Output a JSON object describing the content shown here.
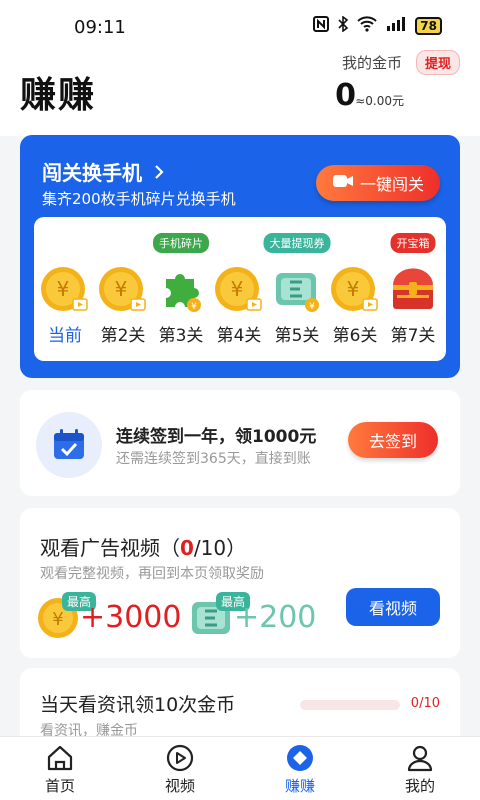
{
  "status_bar": {
    "time": "09:11",
    "battery": "78",
    "icons": [
      "nfc-icon",
      "bluetooth-icon",
      "wifi-icon",
      "signal-icon",
      "battery-icon"
    ]
  },
  "header": {
    "title": "赚赚",
    "coins_label": "我的金币",
    "withdraw_label": "提现",
    "coins_value": "0",
    "money_value": "≈0.00元"
  },
  "challenge": {
    "title": "闯关换手机",
    "subtitle": "集齐200枚手机碎片兑换手机",
    "button_label": "一键闯关",
    "levels": [
      {
        "label": "当前",
        "tag": "",
        "icon": "coin-video-icon",
        "current": true
      },
      {
        "label": "第2关",
        "tag": "",
        "icon": "coin-video-icon"
      },
      {
        "label": "第3关",
        "tag": "手机碎片",
        "icon": "puzzle-piece-icon"
      },
      {
        "label": "第4关",
        "tag": "",
        "icon": "coin-video-icon"
      },
      {
        "label": "第5关",
        "tag": "大量提现券",
        "icon": "withdraw-voucher-icon"
      },
      {
        "label": "第6关",
        "tag": "",
        "icon": "coin-video-icon"
      },
      {
        "label": "第7关",
        "tag": "开宝箱",
        "icon": "treasure-chest-icon"
      }
    ]
  },
  "signin": {
    "title": "连续签到一年，领1000元",
    "subtitle": "还需连续签到365天，直接到账",
    "button_label": "去签到"
  },
  "video_task": {
    "title_prefix": "观看广告视频（",
    "count_done": "0",
    "count_total": "/10）",
    "subtitle": "观看完整视频，再回到本页领取奖励",
    "reward1_badge": "最高",
    "reward1_value": "+3000",
    "reward2_badge": "最高",
    "reward2_value": "+200",
    "button_label": "看视频"
  },
  "news_task": {
    "title": "当天看资讯领10次金币",
    "subtitle": "看资讯，赚金币",
    "progress_text": "0/10",
    "progress_fraction": 0.0
  },
  "tabbar": {
    "items": [
      {
        "label": "首页",
        "icon": "home-icon"
      },
      {
        "label": "视频",
        "icon": "video-play-icon"
      },
      {
        "label": "赚赚",
        "icon": "earn-diamond-icon",
        "active": true
      },
      {
        "label": "我的",
        "icon": "profile-icon"
      }
    ]
  },
  "colors": {
    "accent_blue": "#1b63e8",
    "accent_red": "#e02020",
    "accent_orange": "#ff7a3d",
    "teal": "#6cc5ad"
  }
}
